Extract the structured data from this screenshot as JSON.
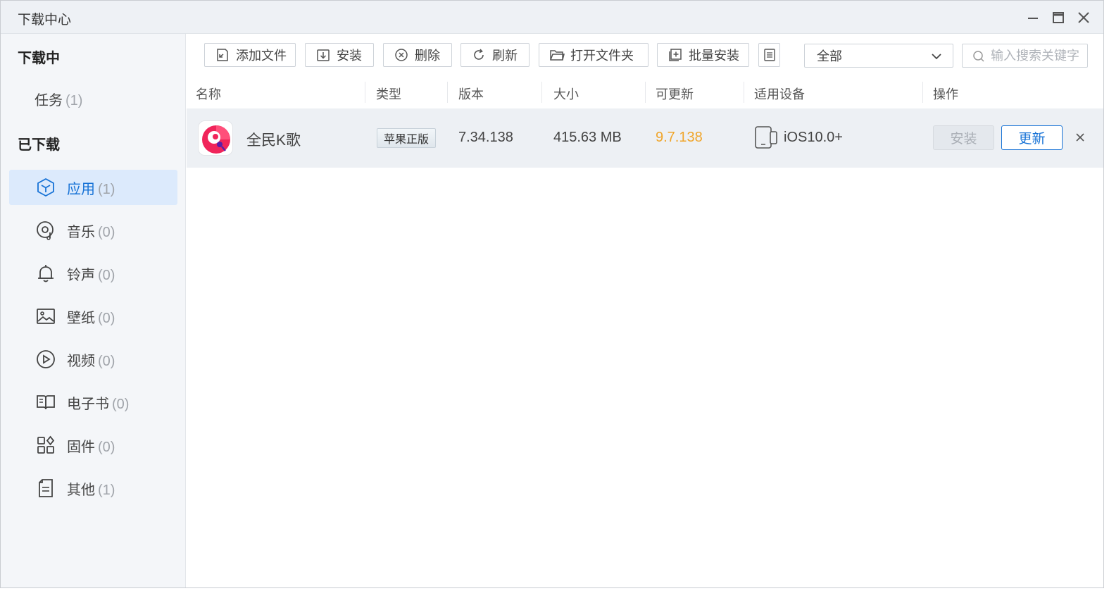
{
  "window": {
    "title": "下载中心"
  },
  "sidebar": {
    "downloading_title": "下载中心",
    "downloading_section": "下载中",
    "task": {
      "label": "任务",
      "count": "(1)"
    },
    "downloaded_section": "已下载",
    "items": [
      {
        "label": "应用",
        "count": "(1)",
        "icon": "app-cube-icon",
        "active": true
      },
      {
        "label": "音乐",
        "count": "(0)",
        "icon": "music-disc-icon",
        "active": false
      },
      {
        "label": "铃声",
        "count": "(0)",
        "icon": "bell-icon",
        "active": false
      },
      {
        "label": "壁纸",
        "count": "(0)",
        "icon": "picture-icon",
        "active": false
      },
      {
        "label": "视频",
        "count": "(0)",
        "icon": "play-circle-icon",
        "active": false
      },
      {
        "label": "电子书",
        "count": "(0)",
        "icon": "book-icon",
        "active": false
      },
      {
        "label": "固件",
        "count": "(0)",
        "icon": "grid-icon",
        "active": false
      },
      {
        "label": "其他",
        "count": "(1)",
        "icon": "document-icon",
        "active": false
      }
    ]
  },
  "toolbar": {
    "add_file": "添加文件",
    "install": "安装",
    "delete": "删除",
    "refresh": "刷新",
    "open_folder": "打开文件夹",
    "batch_install": "批量安装",
    "filter_selected": "全部",
    "search_placeholder": "输入搜索关键字"
  },
  "table": {
    "columns": [
      "名称",
      "类型",
      "版本",
      "大小",
      "可更新",
      "适用设备",
      "操作"
    ],
    "rows": [
      {
        "name": "全民K歌",
        "type": "苹果正版",
        "version": "7.34.138",
        "size": "415.63 MB",
        "update_version": "9.7.138",
        "device": "iOS10.0+",
        "install_label": "安装",
        "update_label": "更新"
      }
    ]
  },
  "colors": {
    "accent": "#1672d6",
    "active_bg": "#dceafc",
    "update_version": "#f0a52a",
    "row_bg": "#edf0f4"
  }
}
